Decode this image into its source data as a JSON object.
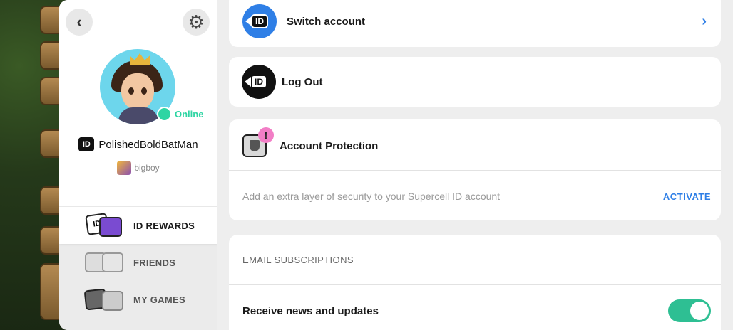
{
  "profile": {
    "username": "PolishedBoldBatMan",
    "status": "Online",
    "game_name": "bigboy",
    "id_badge": "ID"
  },
  "nav": {
    "items": [
      {
        "label": "ID REWARDS",
        "active": true,
        "icon": "id-rewards-icon"
      },
      {
        "label": "FRIENDS",
        "active": false,
        "icon": "friends-icon"
      },
      {
        "label": "MY GAMES",
        "active": false,
        "icon": "my-games-icon"
      }
    ]
  },
  "settings": {
    "switch_account": "Switch account",
    "log_out": "Log Out",
    "account_protection": {
      "title": "Account Protection",
      "description": "Add an extra layer of security to your Supercell ID account",
      "action": "ACTIVATE"
    },
    "email": {
      "section_title": "EMAIL SUBSCRIPTIONS",
      "news_label": "Receive news and updates",
      "news_enabled": true
    }
  },
  "glyphs": {
    "back": "‹",
    "gear": "⚙",
    "chevron": "›",
    "alert": "!",
    "id": "ID"
  },
  "colors": {
    "accent": "#2f7fe6",
    "online": "#2ed5a3",
    "toggle_on": "#2ebf93",
    "alert": "#f27ec6"
  }
}
